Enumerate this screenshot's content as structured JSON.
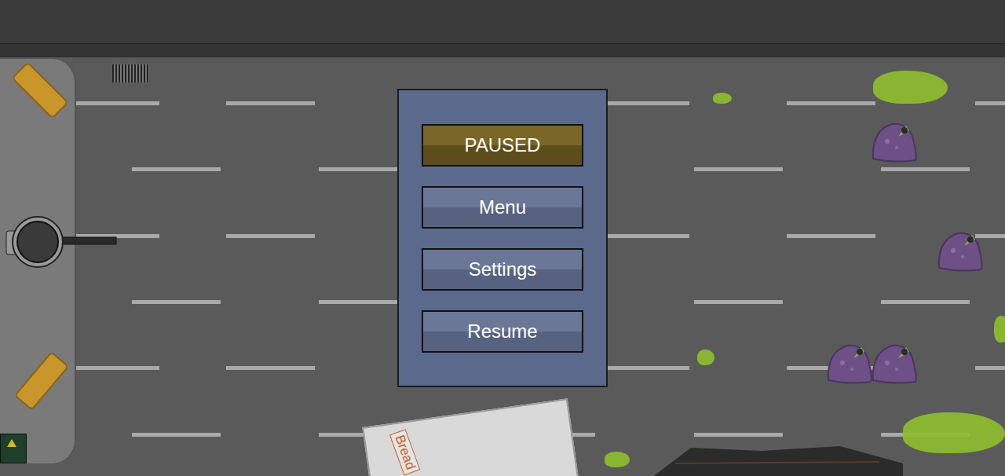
{
  "pause_menu": {
    "title": "PAUSED",
    "buttons": [
      {
        "label": "Menu"
      },
      {
        "label": "Settings"
      },
      {
        "label": "Resume"
      }
    ]
  },
  "world": {
    "crate": {
      "label": "Bread"
    }
  }
}
